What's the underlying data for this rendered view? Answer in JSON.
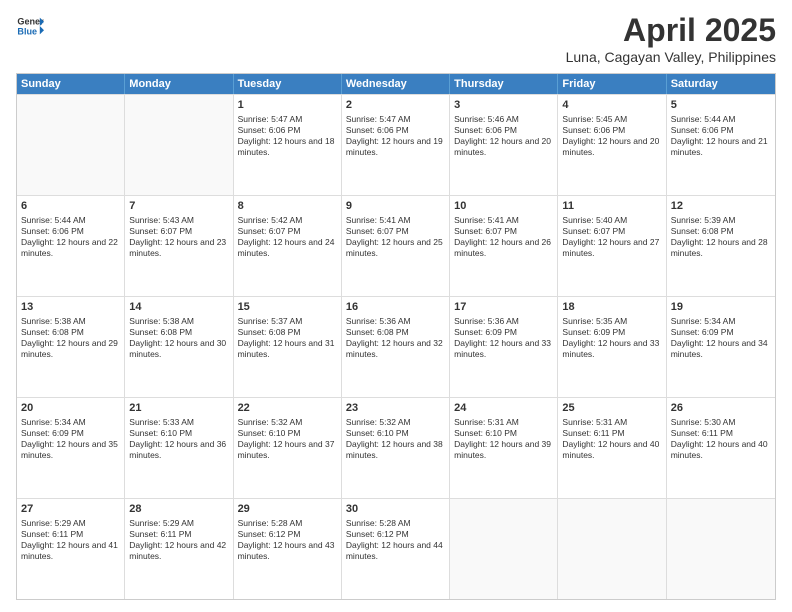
{
  "header": {
    "logo_general": "General",
    "logo_blue": "Blue",
    "title": "April 2025",
    "location": "Luna, Cagayan Valley, Philippines"
  },
  "calendar": {
    "days": [
      "Sunday",
      "Monday",
      "Tuesday",
      "Wednesday",
      "Thursday",
      "Friday",
      "Saturday"
    ],
    "rows": [
      [
        {
          "day": "",
          "empty": true
        },
        {
          "day": "",
          "empty": true
        },
        {
          "day": "1",
          "sunrise": "Sunrise: 5:47 AM",
          "sunset": "Sunset: 6:06 PM",
          "daylight": "Daylight: 12 hours and 18 minutes."
        },
        {
          "day": "2",
          "sunrise": "Sunrise: 5:47 AM",
          "sunset": "Sunset: 6:06 PM",
          "daylight": "Daylight: 12 hours and 19 minutes."
        },
        {
          "day": "3",
          "sunrise": "Sunrise: 5:46 AM",
          "sunset": "Sunset: 6:06 PM",
          "daylight": "Daylight: 12 hours and 20 minutes."
        },
        {
          "day": "4",
          "sunrise": "Sunrise: 5:45 AM",
          "sunset": "Sunset: 6:06 PM",
          "daylight": "Daylight: 12 hours and 20 minutes."
        },
        {
          "day": "5",
          "sunrise": "Sunrise: 5:44 AM",
          "sunset": "Sunset: 6:06 PM",
          "daylight": "Daylight: 12 hours and 21 minutes."
        }
      ],
      [
        {
          "day": "6",
          "sunrise": "Sunrise: 5:44 AM",
          "sunset": "Sunset: 6:06 PM",
          "daylight": "Daylight: 12 hours and 22 minutes."
        },
        {
          "day": "7",
          "sunrise": "Sunrise: 5:43 AM",
          "sunset": "Sunset: 6:07 PM",
          "daylight": "Daylight: 12 hours and 23 minutes."
        },
        {
          "day": "8",
          "sunrise": "Sunrise: 5:42 AM",
          "sunset": "Sunset: 6:07 PM",
          "daylight": "Daylight: 12 hours and 24 minutes."
        },
        {
          "day": "9",
          "sunrise": "Sunrise: 5:41 AM",
          "sunset": "Sunset: 6:07 PM",
          "daylight": "Daylight: 12 hours and 25 minutes."
        },
        {
          "day": "10",
          "sunrise": "Sunrise: 5:41 AM",
          "sunset": "Sunset: 6:07 PM",
          "daylight": "Daylight: 12 hours and 26 minutes."
        },
        {
          "day": "11",
          "sunrise": "Sunrise: 5:40 AM",
          "sunset": "Sunset: 6:07 PM",
          "daylight": "Daylight: 12 hours and 27 minutes."
        },
        {
          "day": "12",
          "sunrise": "Sunrise: 5:39 AM",
          "sunset": "Sunset: 6:08 PM",
          "daylight": "Daylight: 12 hours and 28 minutes."
        }
      ],
      [
        {
          "day": "13",
          "sunrise": "Sunrise: 5:38 AM",
          "sunset": "Sunset: 6:08 PM",
          "daylight": "Daylight: 12 hours and 29 minutes."
        },
        {
          "day": "14",
          "sunrise": "Sunrise: 5:38 AM",
          "sunset": "Sunset: 6:08 PM",
          "daylight": "Daylight: 12 hours and 30 minutes."
        },
        {
          "day": "15",
          "sunrise": "Sunrise: 5:37 AM",
          "sunset": "Sunset: 6:08 PM",
          "daylight": "Daylight: 12 hours and 31 minutes."
        },
        {
          "day": "16",
          "sunrise": "Sunrise: 5:36 AM",
          "sunset": "Sunset: 6:08 PM",
          "daylight": "Daylight: 12 hours and 32 minutes."
        },
        {
          "day": "17",
          "sunrise": "Sunrise: 5:36 AM",
          "sunset": "Sunset: 6:09 PM",
          "daylight": "Daylight: 12 hours and 33 minutes."
        },
        {
          "day": "18",
          "sunrise": "Sunrise: 5:35 AM",
          "sunset": "Sunset: 6:09 PM",
          "daylight": "Daylight: 12 hours and 33 minutes."
        },
        {
          "day": "19",
          "sunrise": "Sunrise: 5:34 AM",
          "sunset": "Sunset: 6:09 PM",
          "daylight": "Daylight: 12 hours and 34 minutes."
        }
      ],
      [
        {
          "day": "20",
          "sunrise": "Sunrise: 5:34 AM",
          "sunset": "Sunset: 6:09 PM",
          "daylight": "Daylight: 12 hours and 35 minutes."
        },
        {
          "day": "21",
          "sunrise": "Sunrise: 5:33 AM",
          "sunset": "Sunset: 6:10 PM",
          "daylight": "Daylight: 12 hours and 36 minutes."
        },
        {
          "day": "22",
          "sunrise": "Sunrise: 5:32 AM",
          "sunset": "Sunset: 6:10 PM",
          "daylight": "Daylight: 12 hours and 37 minutes."
        },
        {
          "day": "23",
          "sunrise": "Sunrise: 5:32 AM",
          "sunset": "Sunset: 6:10 PM",
          "daylight": "Daylight: 12 hours and 38 minutes."
        },
        {
          "day": "24",
          "sunrise": "Sunrise: 5:31 AM",
          "sunset": "Sunset: 6:10 PM",
          "daylight": "Daylight: 12 hours and 39 minutes."
        },
        {
          "day": "25",
          "sunrise": "Sunrise: 5:31 AM",
          "sunset": "Sunset: 6:11 PM",
          "daylight": "Daylight: 12 hours and 40 minutes."
        },
        {
          "day": "26",
          "sunrise": "Sunrise: 5:30 AM",
          "sunset": "Sunset: 6:11 PM",
          "daylight": "Daylight: 12 hours and 40 minutes."
        }
      ],
      [
        {
          "day": "27",
          "sunrise": "Sunrise: 5:29 AM",
          "sunset": "Sunset: 6:11 PM",
          "daylight": "Daylight: 12 hours and 41 minutes."
        },
        {
          "day": "28",
          "sunrise": "Sunrise: 5:29 AM",
          "sunset": "Sunset: 6:11 PM",
          "daylight": "Daylight: 12 hours and 42 minutes."
        },
        {
          "day": "29",
          "sunrise": "Sunrise: 5:28 AM",
          "sunset": "Sunset: 6:12 PM",
          "daylight": "Daylight: 12 hours and 43 minutes."
        },
        {
          "day": "30",
          "sunrise": "Sunrise: 5:28 AM",
          "sunset": "Sunset: 6:12 PM",
          "daylight": "Daylight: 12 hours and 44 minutes."
        },
        {
          "day": "",
          "empty": true
        },
        {
          "day": "",
          "empty": true
        },
        {
          "day": "",
          "empty": true
        }
      ]
    ]
  }
}
